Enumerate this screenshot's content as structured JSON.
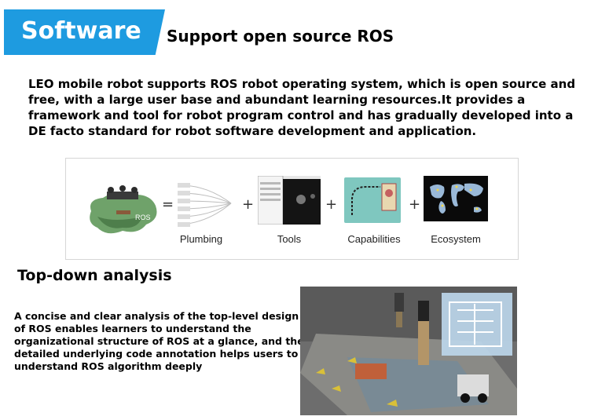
{
  "header": {
    "badge": "Software",
    "subtitle": "Support open source ROS"
  },
  "intro": "LEO mobile robot supports ROS robot operating system, which is open source and free, with a large user base and abundant learning resources.It provides a framework and tool for robot program control and has gradually developed into a DE facto standard for robot software development and application.",
  "ros_diagram": {
    "ros_label": "ROS",
    "equals": "=",
    "plus": "+",
    "items": [
      "Plumbing",
      "Tools",
      "Capabilities",
      "Ecosystem"
    ]
  },
  "analysis": {
    "title": "Top-down analysis",
    "text": "A concise and clear analysis of the top-level design of ROS enables learners to understand the organizational structure of ROS at a glance, and the detailed underlying code annotation helps users to understand ROS algorithm deeply"
  }
}
